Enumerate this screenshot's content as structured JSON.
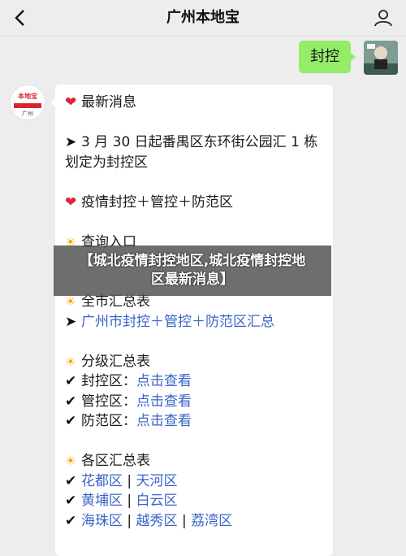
{
  "header": {
    "title": "广州本地宝",
    "back_icon": "chevron-left-icon",
    "profile_icon": "person-icon"
  },
  "outgoing": {
    "text": "封控"
  },
  "bot": {
    "avatar_top": "本地宝",
    "avatar_bottom": "广州"
  },
  "message": {
    "latest_title": "最新消息",
    "latest_line1": "3 月 30 日起番禺区东环街公园汇 1 栋",
    "latest_line2": "划定为封控区",
    "types_title": "疫情封控＋管控＋防范区",
    "query_title": "查询入口",
    "city_title": "全市汇总表",
    "city_link": "广州市封控＋管控＋防范区汇总",
    "level_title": "分级汇总表",
    "level_items": [
      {
        "label": "封控区：",
        "link": "点击查看"
      },
      {
        "label": "管控区：",
        "link": "点击查看"
      },
      {
        "label": "防范区：",
        "link": "点击查看"
      }
    ],
    "district_title": "各区汇总表",
    "district_rows": [
      [
        "花都区",
        "天河区"
      ],
      [
        "黄埔区",
        "白云区"
      ],
      [
        "海珠区",
        "越秀区",
        "荔湾区"
      ]
    ],
    "separator": " | "
  },
  "overlay": {
    "line1": "【城北疫情封控地区,城北疫情封控地",
    "line2": "区最新消息】"
  },
  "colors": {
    "bubble_out": "#95ec69",
    "link": "#3a63c8",
    "heart": "#e0243a"
  }
}
